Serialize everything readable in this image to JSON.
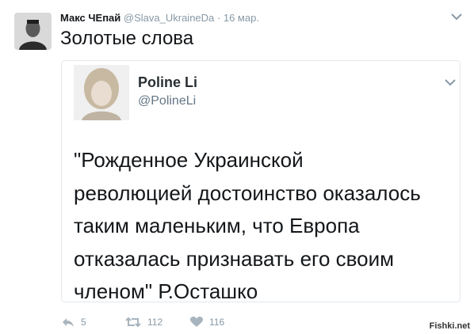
{
  "tweet": {
    "author_name": "Макс ЧЕпай",
    "author_handle": "@Slava_UkraineDa",
    "separator": "·",
    "date": "16 мар.",
    "text": "Золотые слова"
  },
  "quoted": {
    "name": "Poline Li",
    "handle": "@PolineLi",
    "lines": [
      "\"Рожденное Украинской",
      "революцией достоинство оказалось",
      "таким маленьким, что Европа",
      "отказалась признавать его своим",
      "членом\" Р.Осташко"
    ]
  },
  "actions": {
    "reply_count": "5",
    "retweet_count": "112",
    "like_count": "116"
  },
  "watermark": "Fishki.net",
  "icons": {
    "reply": "reply-icon",
    "retweet": "retweet-icon",
    "like": "heart-icon",
    "more": "chevron-down-icon"
  },
  "colors": {
    "text": "#14171a",
    "muted": "#8899a6",
    "border": "#e1e8ed"
  }
}
